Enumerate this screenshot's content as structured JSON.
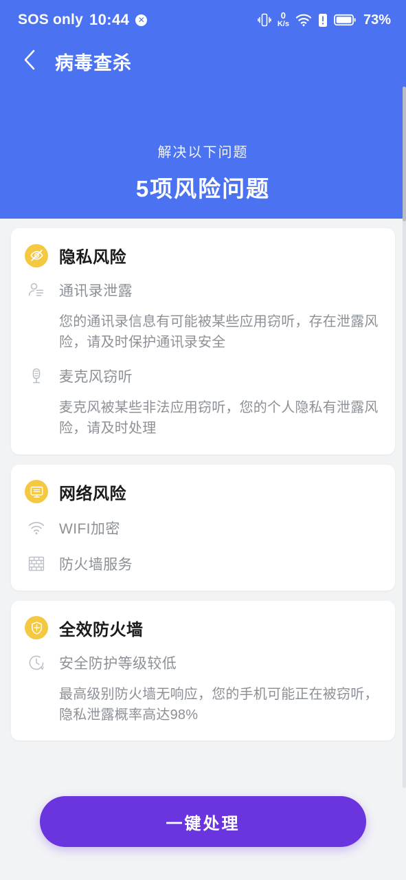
{
  "status_bar": {
    "carrier": "SOS only",
    "clock": "10:44",
    "x_badge": "✕",
    "net_speed_value": "0",
    "net_speed_unit": "K/s",
    "battery_percent": "73%",
    "icons": [
      "vibrate-icon",
      "network-speed-icon",
      "wifi-icon",
      "alert-icon",
      "battery-icon"
    ]
  },
  "nav": {
    "back_icon": "chevron-left-icon",
    "title": "病毒查杀"
  },
  "hero": {
    "subtitle": "解决以下问题",
    "title": "5项风险问题",
    "background_color": "#4b72f0"
  },
  "cards": [
    {
      "icon": "eye-off-icon",
      "title": "隐私风险",
      "rows": [
        {
          "icon": "contact-person-icon",
          "label": "通讯录泄露",
          "desc": "您的通讯录信息有可能被某些应用窃听，存在泄露风险，请及时保护通讯录安全"
        },
        {
          "icon": "microphone-icon",
          "label": "麦克风窃听",
          "desc": "麦克风被某些非法应用窃听，您的个人隐私有泄露风险，请及时处理"
        }
      ]
    },
    {
      "icon": "monitor-icon",
      "title": "网络风险",
      "rows": [
        {
          "icon": "wifi-icon",
          "label": "WIFI加密",
          "desc": ""
        },
        {
          "icon": "brick-wall-icon",
          "label": "防火墙服务",
          "desc": ""
        }
      ]
    },
    {
      "icon": "shield-icon",
      "title": "全效防火墙",
      "rows": [
        {
          "icon": "clock-icon",
          "label": "安全防护等级较低",
          "desc": "最高级别防火墙无响应，您的手机可能正在被窃听，隐私泄露概率高达98%"
        }
      ]
    }
  ],
  "footer": {
    "cta_label": "一键处理",
    "cta_color": "#6a35de"
  },
  "theme": {
    "accent_blue": "#4b72f0",
    "accent_yellow": "#f5c842",
    "page_background": "#f2f3f5",
    "card_background": "#ffffff",
    "muted_text": "#8c9097"
  }
}
